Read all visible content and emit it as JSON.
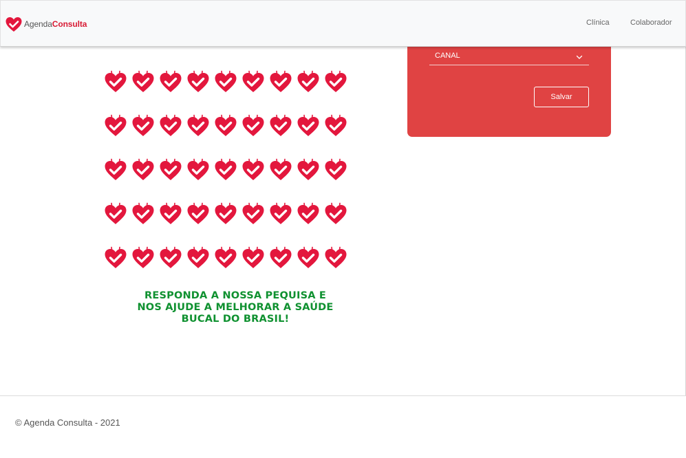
{
  "header": {
    "brand": {
      "part1": "Agenda",
      "part2": "Consulta",
      "logo_icon": "heart-check-icon"
    },
    "nav": [
      {
        "id": "clinica",
        "label": "Clínica"
      },
      {
        "id": "colaborador",
        "label": "Colaborador"
      }
    ]
  },
  "banner": {
    "icon": "heart-check-icon",
    "rows": 5,
    "columns": 9,
    "heart_color": "#e3173d",
    "text_lines": [
      "RESPONDA A NOSSA PEQUISA E",
      "NOS AJUDE A MELHORAR A SAÚDE",
      "BUCAL DO BRASIL!"
    ],
    "text_color": "#0f9130"
  },
  "form": {
    "card_color": "#e04343",
    "select": {
      "value": "CANAL",
      "icon": "chevron-down-icon"
    },
    "save_label": "Salvar"
  },
  "footer": {
    "copyright": "© Agenda Consulta - 2021"
  }
}
